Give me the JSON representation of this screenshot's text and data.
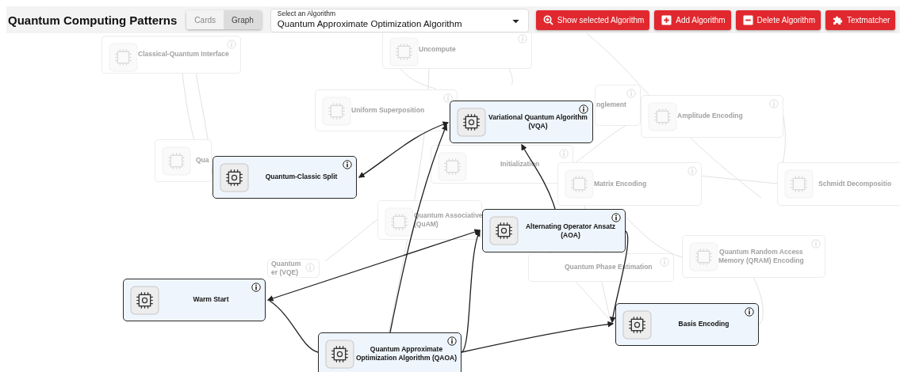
{
  "header": {
    "title": "Quantum Computing Patterns",
    "view_toggle": [
      {
        "label": "Cards",
        "selected": false
      },
      {
        "label": "Graph",
        "selected": true
      }
    ],
    "select": {
      "label": "Select an Algorithm",
      "value": "Quantum Approximate Optimization Algorithm"
    },
    "buttons": [
      {
        "label": "Show selected Algorithm",
        "kind": "search"
      },
      {
        "label": "Add Algorithm",
        "kind": "add"
      },
      {
        "label": "Delete Algorithm",
        "kind": "delete"
      },
      {
        "label": "Textmatcher",
        "kind": "puzzle"
      }
    ]
  },
  "graph": {
    "nodes": [
      {
        "lines": [
          "Classical-Quantum Interface"
        ],
        "highlighted": false
      },
      {
        "lines": [
          "Uncompute"
        ],
        "highlighted": false
      },
      {
        "lines": [
          "Uniform Superposition"
        ],
        "highlighted": false
      },
      {
        "lines": [
          "nglement"
        ],
        "highlighted": false
      },
      {
        "lines": [
          "Amplitude Encoding"
        ],
        "highlighted": false
      },
      {
        "lines": [
          "Qua"
        ],
        "highlighted": false
      },
      {
        "lines": [
          "Initialization"
        ],
        "highlighted": false
      },
      {
        "lines": [
          "Matrix Encoding"
        ],
        "highlighted": false
      },
      {
        "lines": [
          "Schmidt Decompositio"
        ],
        "highlighted": false
      },
      {
        "lines": [
          "Quantum Associative",
          "(QuAM)"
        ],
        "highlighted": false
      },
      {
        "lines": [
          "Quantum",
          "er (VQE)"
        ],
        "highlighted": false
      },
      {
        "lines": [
          "Quantum Phase Estimation"
        ],
        "highlighted": false
      },
      {
        "lines": [
          "Quantum Random Access",
          "Memory (QRAM) Encoding"
        ],
        "highlighted": false
      },
      {
        "lines": [
          "Variational Quantum Algorithm",
          "(VQA)"
        ],
        "highlighted": true
      },
      {
        "lines": [
          "Quantum-Classic Split"
        ],
        "highlighted": true
      },
      {
        "lines": [
          "Alternating Operator Ansatz",
          "(AOA)"
        ],
        "highlighted": true
      },
      {
        "lines": [
          "Warm Start"
        ],
        "highlighted": true
      },
      {
        "lines": [
          "Quantum Approximate",
          "Optimization Algorithm (QAOA)"
        ],
        "highlighted": true
      },
      {
        "lines": [
          "Basis Encoding"
        ],
        "highlighted": true
      }
    ]
  }
}
